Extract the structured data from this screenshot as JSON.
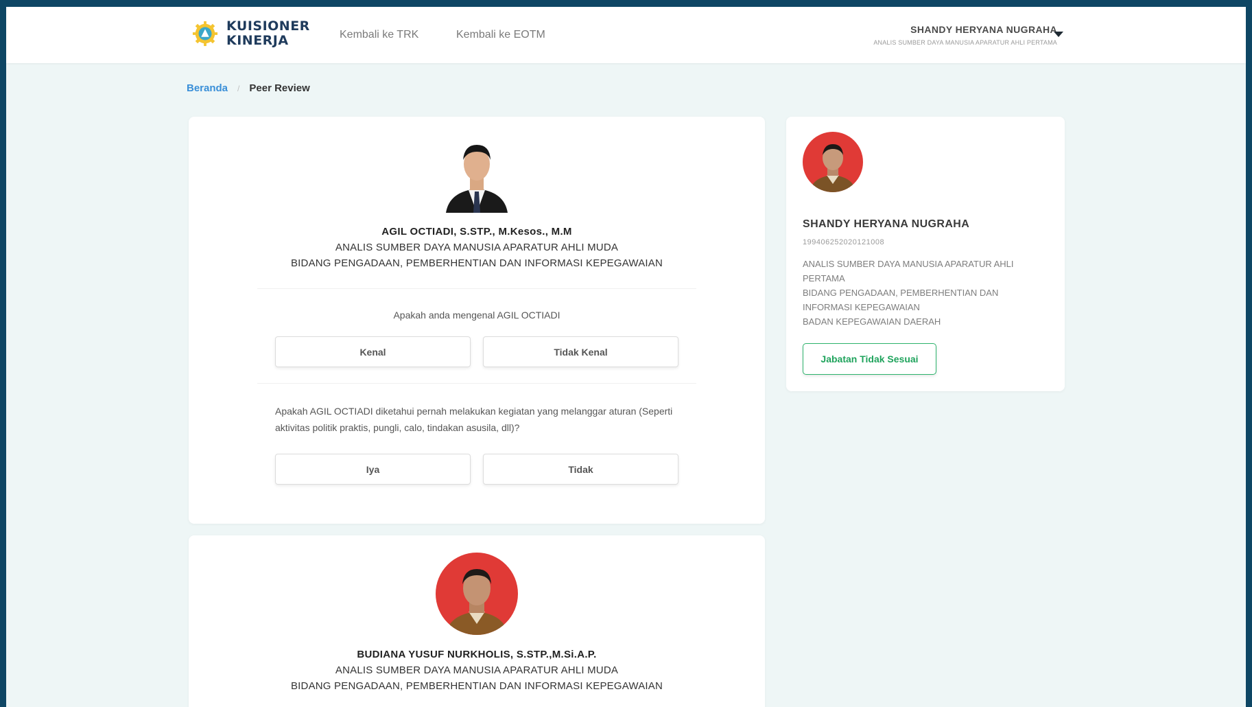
{
  "header": {
    "brand_line1": "KUISIONER",
    "brand_line2": "KINERJA",
    "nav": [
      {
        "label": "Kembali ke TRK"
      },
      {
        "label": "Kembali ke EOTM"
      }
    ],
    "user": {
      "name": "SHANDY HERYANA NUGRAHA",
      "role": "ANALIS SUMBER DAYA MANUSIA APARATUR AHLI PERTAMA"
    }
  },
  "breadcrumb": {
    "home": "Beranda",
    "separator": "/",
    "current": "Peer Review"
  },
  "reviews": [
    {
      "name": "AGIL OCTIADI, S.STP., M.Kesos., M.M",
      "position": "ANALIS SUMBER DAYA MANUSIA APARATUR AHLI MUDA",
      "unit": "BIDANG PENGADAAN, PEMBERHENTIAN DAN INFORMASI KEPEGAWAIAN",
      "q1": "Apakah anda mengenal AGIL OCTIADI",
      "q1_options": [
        "Kenal",
        "Tidak Kenal"
      ],
      "q2": "Apakah AGIL OCTIADI diketahui pernah melakukan kegiatan yang melanggar aturan (Seperti aktivitas politik praktis, pungli, calo, tindakan asusila, dll)?",
      "q2_options": [
        "Iya",
        "Tidak"
      ]
    },
    {
      "name": "BUDIANA YUSUF NURKHOLIS, S.STP.,M.Si.A.P.",
      "position": "ANALIS SUMBER DAYA MANUSIA APARATUR AHLI MUDA",
      "unit": "BIDANG PENGADAAN, PEMBERHENTIAN DAN INFORMASI KEPEGAWAIAN"
    }
  ],
  "profile": {
    "name": "SHANDY HERYANA NUGRAHA",
    "nip": "199406252020121008",
    "position": "ANALIS SUMBER DAYA MANUSIA APARATUR AHLI PERTAMA",
    "unit": "BIDANG PENGADAAN, PEMBERHENTIAN DAN INFORMASI KEPEGAWAIAN",
    "agency": "BADAN KEPEGAWAIAN DAERAH",
    "button": "Jabatan Tidak Sesuai"
  },
  "colors": {
    "background_frame": "#0e4664",
    "page_bg": "#eef6f6",
    "link_blue": "#3a8fd8",
    "accent_green": "#1fa35c",
    "avatar_red": "#e03a36"
  }
}
